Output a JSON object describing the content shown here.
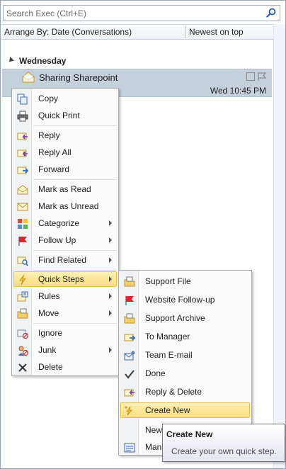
{
  "search": {
    "placeholder": "Search Exec (Ctrl+E)"
  },
  "arrange": {
    "label": "Arrange By: Date (Conversations)",
    "order": "Newest on top"
  },
  "group": {
    "label": "Wednesday"
  },
  "mail": {
    "subject": "Sharing Sharepoint",
    "date": "Wed 10:45 PM"
  },
  "context_menu": {
    "items": [
      {
        "label": "Copy",
        "icon": "copy-icon"
      },
      {
        "label": "Quick Print",
        "icon": "printer-icon"
      },
      {
        "label": "Reply",
        "icon": "reply-icon"
      },
      {
        "label": "Reply All",
        "icon": "reply-all-icon"
      },
      {
        "label": "Forward",
        "icon": "forward-icon"
      },
      {
        "label": "Mark as Read",
        "icon": "mark-read-icon"
      },
      {
        "label": "Mark as Unread",
        "icon": "mark-unread-icon"
      },
      {
        "label": "Categorize",
        "icon": "categorize-icon"
      },
      {
        "label": "Follow Up",
        "icon": "flag-icon"
      },
      {
        "label": "Find Related",
        "icon": "find-related-icon"
      },
      {
        "label": "Quick Steps",
        "icon": "lightning-icon"
      },
      {
        "label": "Rules",
        "icon": "rules-icon"
      },
      {
        "label": "Move",
        "icon": "move-icon"
      },
      {
        "label": "Ignore",
        "icon": "ignore-icon"
      },
      {
        "label": "Junk",
        "icon": "junk-icon"
      },
      {
        "label": "Delete",
        "icon": "delete-icon"
      }
    ]
  },
  "quick_steps_menu": {
    "items": [
      {
        "label": "Support File",
        "icon": "move-to-folder-icon"
      },
      {
        "label": "Website Follow-up",
        "icon": "flag-icon"
      },
      {
        "label": "Support Archive",
        "icon": "move-to-folder-icon"
      },
      {
        "label": "To Manager",
        "icon": "forward-icon"
      },
      {
        "label": "Team E-mail",
        "icon": "team-email-icon"
      },
      {
        "label": "Done",
        "icon": "checkmark-icon"
      },
      {
        "label": "Reply & Delete",
        "icon": "reply-delete-icon"
      },
      {
        "label": "Create New",
        "icon": "create-new-icon"
      },
      {
        "label": "New",
        "icon": "none"
      },
      {
        "label": "Man",
        "icon": "manage-icon"
      }
    ]
  },
  "tooltip": {
    "title": "Create New",
    "text": "Create your own quick step."
  },
  "colors": {
    "highlight": "#f9de7e",
    "selection": "#c5d0dd",
    "flag": "#d8262c",
    "accent": "#2f6db5"
  }
}
